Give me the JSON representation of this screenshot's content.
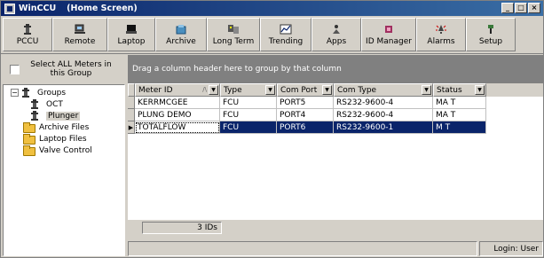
{
  "window": {
    "title": "WinCCU",
    "subtitle": "(Home Screen)",
    "buttons": [
      "_",
      "□",
      "×"
    ]
  },
  "toolbar": {
    "buttons": [
      {
        "label": "PCCU",
        "icon": "pccu-icon"
      },
      {
        "label": "Remote",
        "icon": "remote-icon"
      },
      {
        "label": "Laptop",
        "icon": "laptop-icon"
      },
      {
        "label": "Archive",
        "icon": "archive-icon"
      },
      {
        "label": "Long Term",
        "icon": "long-term-icon"
      },
      {
        "label": "Trending",
        "icon": "trending-icon"
      },
      {
        "label": "Apps",
        "icon": "apps-icon"
      },
      {
        "label": "ID Manager",
        "icon": "id-manager-icon"
      },
      {
        "label": "Alarms",
        "icon": "alarms-icon"
      },
      {
        "label": "Setup",
        "icon": "setup-icon"
      }
    ]
  },
  "left_panel": {
    "select_all_label": "Select ALL Meters in this Group",
    "tree": [
      {
        "label": "Groups",
        "icon": "meter-icon",
        "expander": "−"
      },
      {
        "label": "OCT",
        "icon": "meter-icon"
      },
      {
        "label": "Plunger",
        "icon": "meter-icon",
        "selected": true
      },
      {
        "label": "Archive Files",
        "icon": "folder-icon"
      },
      {
        "label": "Laptop Files",
        "icon": "folder-icon"
      },
      {
        "label": "Valve Control",
        "icon": "folder-icon"
      }
    ]
  },
  "grid": {
    "group_hint": "Drag a column header here to group by that column",
    "columns": [
      "Meter ID",
      "Type",
      "Com Port",
      "Com Type",
      "Status"
    ],
    "rows": [
      [
        "KERRMCGEE",
        "FCU",
        "PORT5",
        "RS232-9600-4",
        "MA T"
      ],
      [
        "PLUNG DEMO",
        "FCU",
        "PORT4",
        "RS232-9600-4",
        "MA T"
      ],
      [
        "TOTALFLOW",
        "FCU",
        "PORT6",
        "RS232-9600-1",
        "M  T"
      ]
    ],
    "selected_row": 2,
    "count_label": "3 IDs"
  },
  "status_bar": {
    "login": "Login: User"
  },
  "colors": {
    "title_bar": "#0a246a",
    "selection": "#0a246a",
    "chrome": "#d4d0c8",
    "group_bar": "#808080"
  }
}
